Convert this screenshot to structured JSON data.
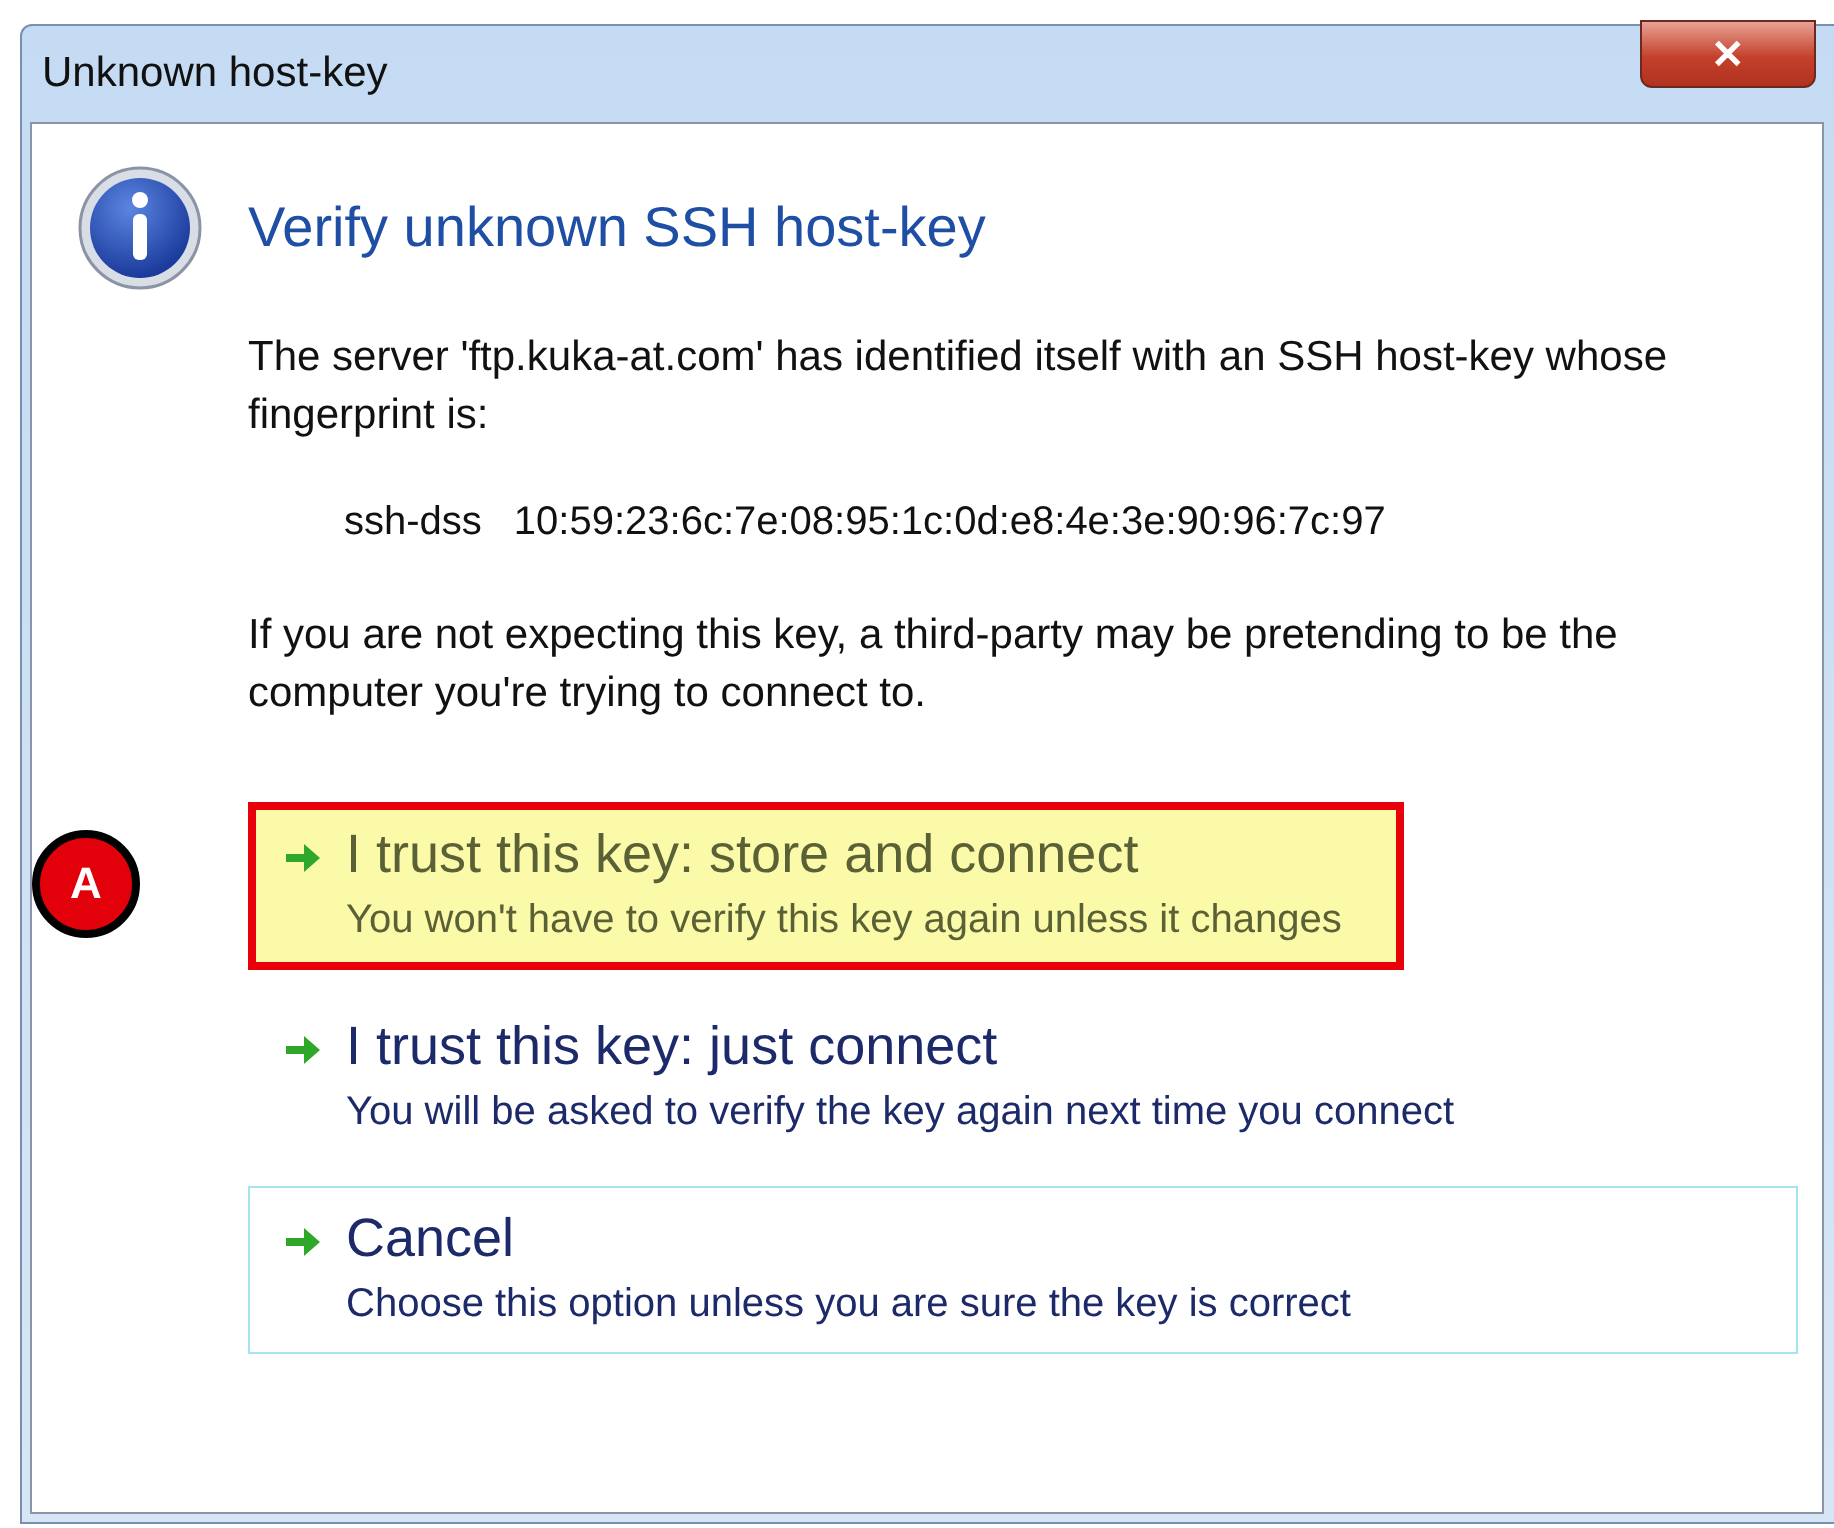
{
  "window": {
    "title": "Unknown host-key",
    "close": "✕"
  },
  "heading": "Verify unknown SSH host-key",
  "message": "The server 'ftp.kuka-at.com' has identified itself with an SSH host-key whose fingerprint is:",
  "fingerprint": {
    "type": "ssh-dss",
    "value": "10:59:23:6c:7e:08:95:1c:0d:e8:4e:3e:90:96:7c:97"
  },
  "warning": "If you are not expecting this key, a third-party may be pretending to be the computer you're trying to connect to.",
  "options": [
    {
      "title": "I trust this key: store and connect",
      "detail": "You won't have to verify this key again unless it changes",
      "highlighted": true,
      "focused": false,
      "annotation": "A"
    },
    {
      "title": "I trust this key: just connect",
      "detail": "You will be asked to verify the key again next time you connect",
      "highlighted": false,
      "focused": false
    },
    {
      "title": "Cancel",
      "detail": "Choose this option unless you are sure the key is correct",
      "highlighted": false,
      "focused": true
    }
  ]
}
